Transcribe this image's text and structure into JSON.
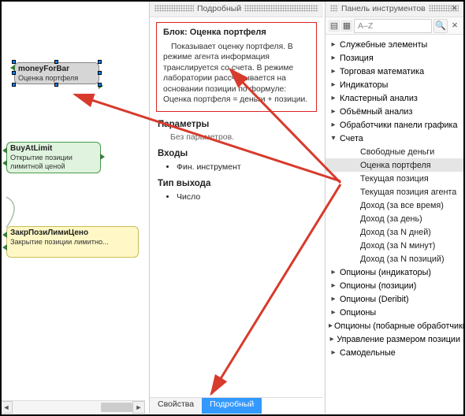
{
  "panels": {
    "mid_title": "Подробный",
    "right_title": "Панель инструментов"
  },
  "search": {
    "placeholder": "A–Z"
  },
  "redbox": {
    "heading_prefix": "Блок:",
    "heading_name": "Оценка портфеля",
    "body": "Показывает оценку портфеля. В режиме агента информация транслируется со счета. В режиме лаборатории рассчитывается на основании позиции по формуле: Оценка портфеля = деньги + позиции."
  },
  "details": {
    "params_title": "Параметры",
    "params_sub": "Без параметров.",
    "inputs_title": "Входы",
    "inputs_items": [
      "Фин. инструмент"
    ],
    "outtype_title": "Тип выхода",
    "outtype_items": [
      "Число"
    ]
  },
  "tabs": {
    "properties": "Свойства",
    "detailed": "Подробный"
  },
  "tree": [
    {
      "label": "Служебные элементы",
      "exp": false,
      "lv": 0
    },
    {
      "label": "Позиция",
      "exp": false,
      "lv": 0
    },
    {
      "label": "Торговая математика",
      "exp": false,
      "lv": 0
    },
    {
      "label": "Индикаторы",
      "exp": false,
      "lv": 0
    },
    {
      "label": "Кластерный анализ",
      "exp": false,
      "lv": 0
    },
    {
      "label": "Объёмный анализ",
      "exp": false,
      "lv": 0
    },
    {
      "label": "Обработчики панели графика",
      "exp": false,
      "lv": 0
    },
    {
      "label": "Счета",
      "exp": true,
      "lv": 0
    },
    {
      "label": "Свободные деньги",
      "lv": 1
    },
    {
      "label": "Оценка портфеля",
      "lv": 1,
      "sel": true
    },
    {
      "label": "Текущая позиция",
      "lv": 1
    },
    {
      "label": "Текущая позиция агента",
      "lv": 1
    },
    {
      "label": "Доход (за все время)",
      "lv": 1
    },
    {
      "label": "Доход (за день)",
      "lv": 1
    },
    {
      "label": "Доход (за N дней)",
      "lv": 1
    },
    {
      "label": "Доход (за N минут)",
      "lv": 1
    },
    {
      "label": "Доход (за N позиций)",
      "lv": 1
    },
    {
      "label": "Опционы (индикаторы)",
      "exp": false,
      "lv": 0
    },
    {
      "label": "Опционы (позиции)",
      "exp": false,
      "lv": 0
    },
    {
      "label": "Опционы (Deribit)",
      "exp": false,
      "lv": 0
    },
    {
      "label": "Опционы",
      "exp": false,
      "lv": 0
    },
    {
      "label": "Опционы (побарные обработчики)",
      "exp": false,
      "lv": 0
    },
    {
      "label": "Управление размером позиции",
      "exp": false,
      "lv": 0
    },
    {
      "label": "Самодельные",
      "exp": false,
      "lv": 0
    }
  ],
  "nodes": {
    "n1": {
      "title": "moneyForBar",
      "sub": "Оценка портфеля"
    },
    "n2": {
      "title": "BuyAtLimit",
      "sub": "Открытие позиции лимитной ценой"
    },
    "n3": {
      "title": "ЗакрПозиЛимиЦено",
      "sub": "Закрытие позиции лимитно..."
    }
  },
  "arrows_color": "#d83a2b"
}
